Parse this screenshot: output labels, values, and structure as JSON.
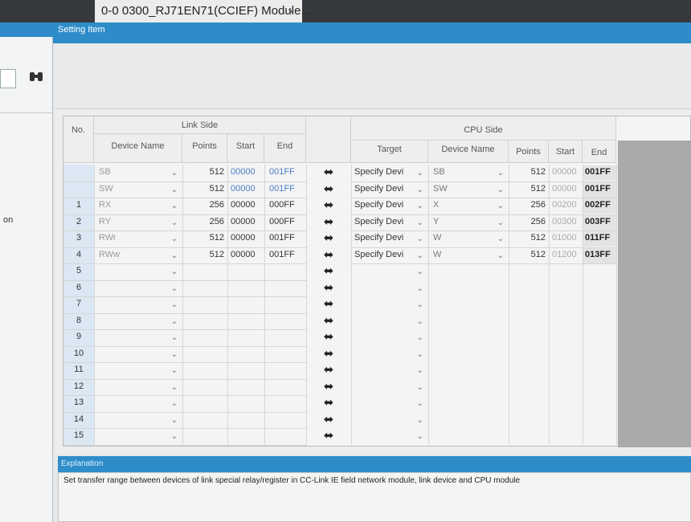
{
  "tabs": {
    "doc_tab_title": "0-0 0300_RJ71EN71(CCIEF) Module...",
    "close_glyph": "×"
  },
  "panel": {
    "setting_item": "Setting Item",
    "explanation_title": "Explanation",
    "explanation_text": "Set transfer range between devices of link special relay/register in CC-Link IE field network module, link device and CPU module"
  },
  "left": {
    "cut_text": "on"
  },
  "grid": {
    "headers": {
      "no": "No.",
      "link_side": "Link Side",
      "device_name": "Device Name",
      "points": "Points",
      "start": "Start",
      "end": "End",
      "cpu_side": "CPU Side",
      "target": "Target"
    },
    "link_rows": [
      {
        "no": "",
        "device": "SB",
        "points": "512",
        "start": "00000",
        "end": "001FF"
      },
      {
        "no": "",
        "device": "SW",
        "points": "512",
        "start": "00000",
        "end": "001FF"
      },
      {
        "no": "1",
        "device": "RX",
        "points": "256",
        "start": "00000",
        "end": "000FF"
      },
      {
        "no": "2",
        "device": "RY",
        "points": "256",
        "start": "00000",
        "end": "000FF"
      },
      {
        "no": "3",
        "device": "RWr",
        "points": "512",
        "start": "00000",
        "end": "001FF"
      },
      {
        "no": "4",
        "device": "RWw",
        "points": "512",
        "start": "00000",
        "end": "001FF"
      },
      {
        "no": "5",
        "device": "",
        "points": "",
        "start": "",
        "end": ""
      },
      {
        "no": "6",
        "device": "",
        "points": "",
        "start": "",
        "end": ""
      },
      {
        "no": "7",
        "device": "",
        "points": "",
        "start": "",
        "end": ""
      },
      {
        "no": "8",
        "device": "",
        "points": "",
        "start": "",
        "end": ""
      },
      {
        "no": "9",
        "device": "",
        "points": "",
        "start": "",
        "end": ""
      },
      {
        "no": "10",
        "device": "",
        "points": "",
        "start": "",
        "end": ""
      },
      {
        "no": "11",
        "device": "",
        "points": "",
        "start": "",
        "end": ""
      },
      {
        "no": "12",
        "device": "",
        "points": "",
        "start": "",
        "end": ""
      },
      {
        "no": "13",
        "device": "",
        "points": "",
        "start": "",
        "end": ""
      },
      {
        "no": "14",
        "device": "",
        "points": "",
        "start": "",
        "end": ""
      },
      {
        "no": "15",
        "device": "",
        "points": "",
        "start": "",
        "end": ""
      }
    ],
    "cpu_rows": [
      {
        "target": "Specify Devi",
        "device": "SB",
        "points": "512",
        "start": "00000",
        "end": "001FF"
      },
      {
        "target": "Specify Devi",
        "device": "SW",
        "points": "512",
        "start": "00000",
        "end": "001FF"
      },
      {
        "target": "Specify Devi",
        "device": "X",
        "points": "256",
        "start": "00200",
        "end": "002FF"
      },
      {
        "target": "Specify Devi",
        "device": "Y",
        "points": "256",
        "start": "00300",
        "end": "003FF"
      },
      {
        "target": "Specify Devi",
        "device": "W",
        "points": "512",
        "start": "01000",
        "end": "011FF"
      },
      {
        "target": "Specify Devi",
        "device": "W",
        "points": "512",
        "start": "01200",
        "end": "013FF"
      }
    ],
    "arrow_glyph": "⬌",
    "dropdown_glyph": "⌄"
  },
  "colors": {
    "accent": "#2E8DC9",
    "tab_bar": "#35393E"
  }
}
